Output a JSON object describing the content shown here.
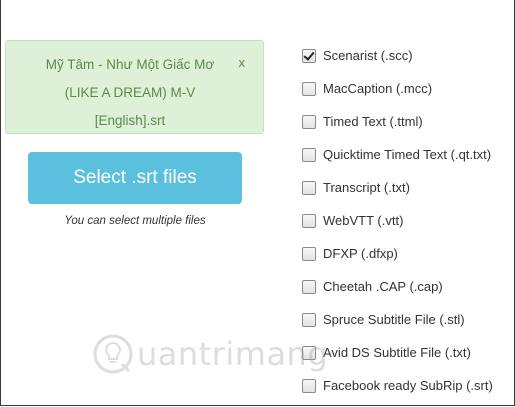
{
  "uploaded_file": {
    "line1": "Mỹ Tâm - Như Một Giấc Mơ",
    "line2": "(LIKE A DREAM) M-V",
    "line3": "[English].srt",
    "remove_label": "x"
  },
  "select_button": {
    "label": "Select .srt files",
    "color": "#5bc0de"
  },
  "hint": "You can select multiple files",
  "formats": [
    {
      "label": "Scenarist (.scc)",
      "checked": true
    },
    {
      "label": "MacCaption (.mcc)",
      "checked": false
    },
    {
      "label": "Timed Text (.ttml)",
      "checked": false
    },
    {
      "label": "Quicktime Timed Text (.qt.txt)",
      "checked": false
    },
    {
      "label": "Transcript (.txt)",
      "checked": false
    },
    {
      "label": "WebVTT (.vtt)",
      "checked": false
    },
    {
      "label": "DFXP (.dfxp)",
      "checked": false
    },
    {
      "label": "Cheetah .CAP (.cap)",
      "checked": false
    },
    {
      "label": "Spruce Subtitle File (.stl)",
      "checked": false
    },
    {
      "label": "Avid DS Subtitle File (.txt)",
      "checked": false
    },
    {
      "label": "Facebook ready SubRip (.srt)",
      "checked": false
    }
  ],
  "watermark": {
    "text": "uantrimang",
    "icon": "lightbulb-logo-icon"
  }
}
